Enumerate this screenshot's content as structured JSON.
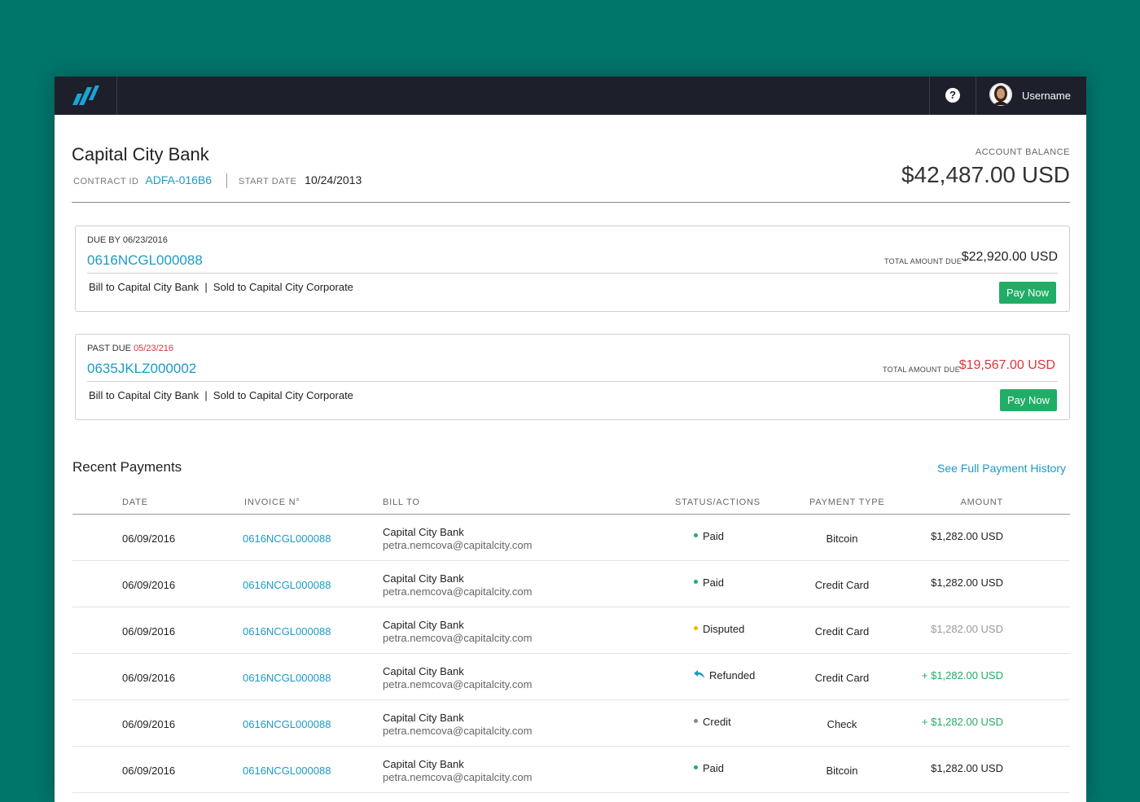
{
  "topbar": {
    "help_symbol": "?",
    "username": "Username"
  },
  "header": {
    "bank_name": "Capital City Bank",
    "contract_label": "CONTRACT ID",
    "contract_id": "ADFA-016B6",
    "start_label": "START DATE",
    "start_date": "10/24/2013",
    "balance_label": "ACCOUNT BALANCE",
    "balance_value": "$42,487.00 USD"
  },
  "cards": [
    {
      "status_label": "DUE BY",
      "date": "06/23/2016",
      "invoice": "0616NCGL000088",
      "total_label": "TOTAL AMOUNT DUE",
      "total": "$22,920.00 USD",
      "bill_text": "Bill to Capital City Bank  |  Sold to Capital City Corporate",
      "pay_label": "Pay Now"
    },
    {
      "status_label": "PAST DUE",
      "date": "05/23/216",
      "invoice": "0635JKLZ000002",
      "total_label": "TOTAL AMOUNT DUE",
      "total": "$19,567.00 USD",
      "bill_text": "Bill to Capital City Bank  |  Sold to Capital City Corporate",
      "pay_label": "Pay Now"
    }
  ],
  "payments": {
    "title": "Recent Payments",
    "history_link": "See Full Payment History",
    "columns": [
      "DATE",
      "INVOICE N°",
      "BILL TO",
      "STATUS/ACTIONS",
      "PAYMENT TYPE",
      "AMOUNT"
    ],
    "rows": [
      {
        "date": "06/09/2016",
        "invoice": "0616NCGL000088",
        "bill_name": "Capital City Bank",
        "bill_email": "petra.nemcova@capitalcity.com",
        "status": "Paid",
        "status_icon": "green-dot-icon",
        "type": "Bitcoin",
        "amount": "$1,282.00 USD",
        "amount_color": "#222222"
      },
      {
        "date": "06/09/2016",
        "invoice": "0616NCGL000088",
        "bill_name": "Capital City Bank",
        "bill_email": "petra.nemcova@capitalcity.com",
        "status": "Paid",
        "status_icon": "green-dot-icon",
        "type": "Credit Card",
        "amount": "$1,282.00 USD",
        "amount_color": "#222222"
      },
      {
        "date": "06/09/2016",
        "invoice": "0616NCGL000088",
        "bill_name": "Capital City Bank",
        "bill_email": "petra.nemcova@capitalcity.com",
        "status": "Disputed",
        "status_icon": "yellow-dot-icon",
        "type": "Credit Card",
        "amount": "$1,282.00 USD",
        "amount_color": "#999999"
      },
      {
        "date": "06/09/2016",
        "invoice": "0616NCGL000088",
        "bill_name": "Capital City Bank",
        "bill_email": "petra.nemcova@capitalcity.com",
        "status": "Refunded",
        "status_icon": "reply-arrow-icon",
        "type": "Credit Card",
        "amount": "+ $1,282.00 USD",
        "amount_color": "#21ad66"
      },
      {
        "date": "06/09/2016",
        "invoice": "0616NCGL000088",
        "bill_name": "Capital City Bank",
        "bill_email": "petra.nemcova@capitalcity.com",
        "status": "Credit",
        "status_icon": "gray-dot-icon",
        "type": "Check",
        "amount": "+ $1,282.00 USD",
        "amount_color": "#21ad66"
      },
      {
        "date": "06/09/2016",
        "invoice": "0616NCGL000088",
        "bill_name": "Capital City Bank",
        "bill_email": "petra.nemcova@capitalcity.com",
        "status": "Paid",
        "status_icon": "green-dot-icon",
        "type": "Bitcoin",
        "amount": "$1,282.00 USD",
        "amount_color": "#222222"
      }
    ]
  },
  "colors": {
    "background": "#00756a",
    "topbar": "#1d1f2b",
    "link": "#1a9bc6",
    "pay_button": "#21ad66",
    "past_due": "#d9363b",
    "dot_green": "#21ad66",
    "dot_yellow": "#f2b705",
    "dot_gray": "#888888"
  }
}
